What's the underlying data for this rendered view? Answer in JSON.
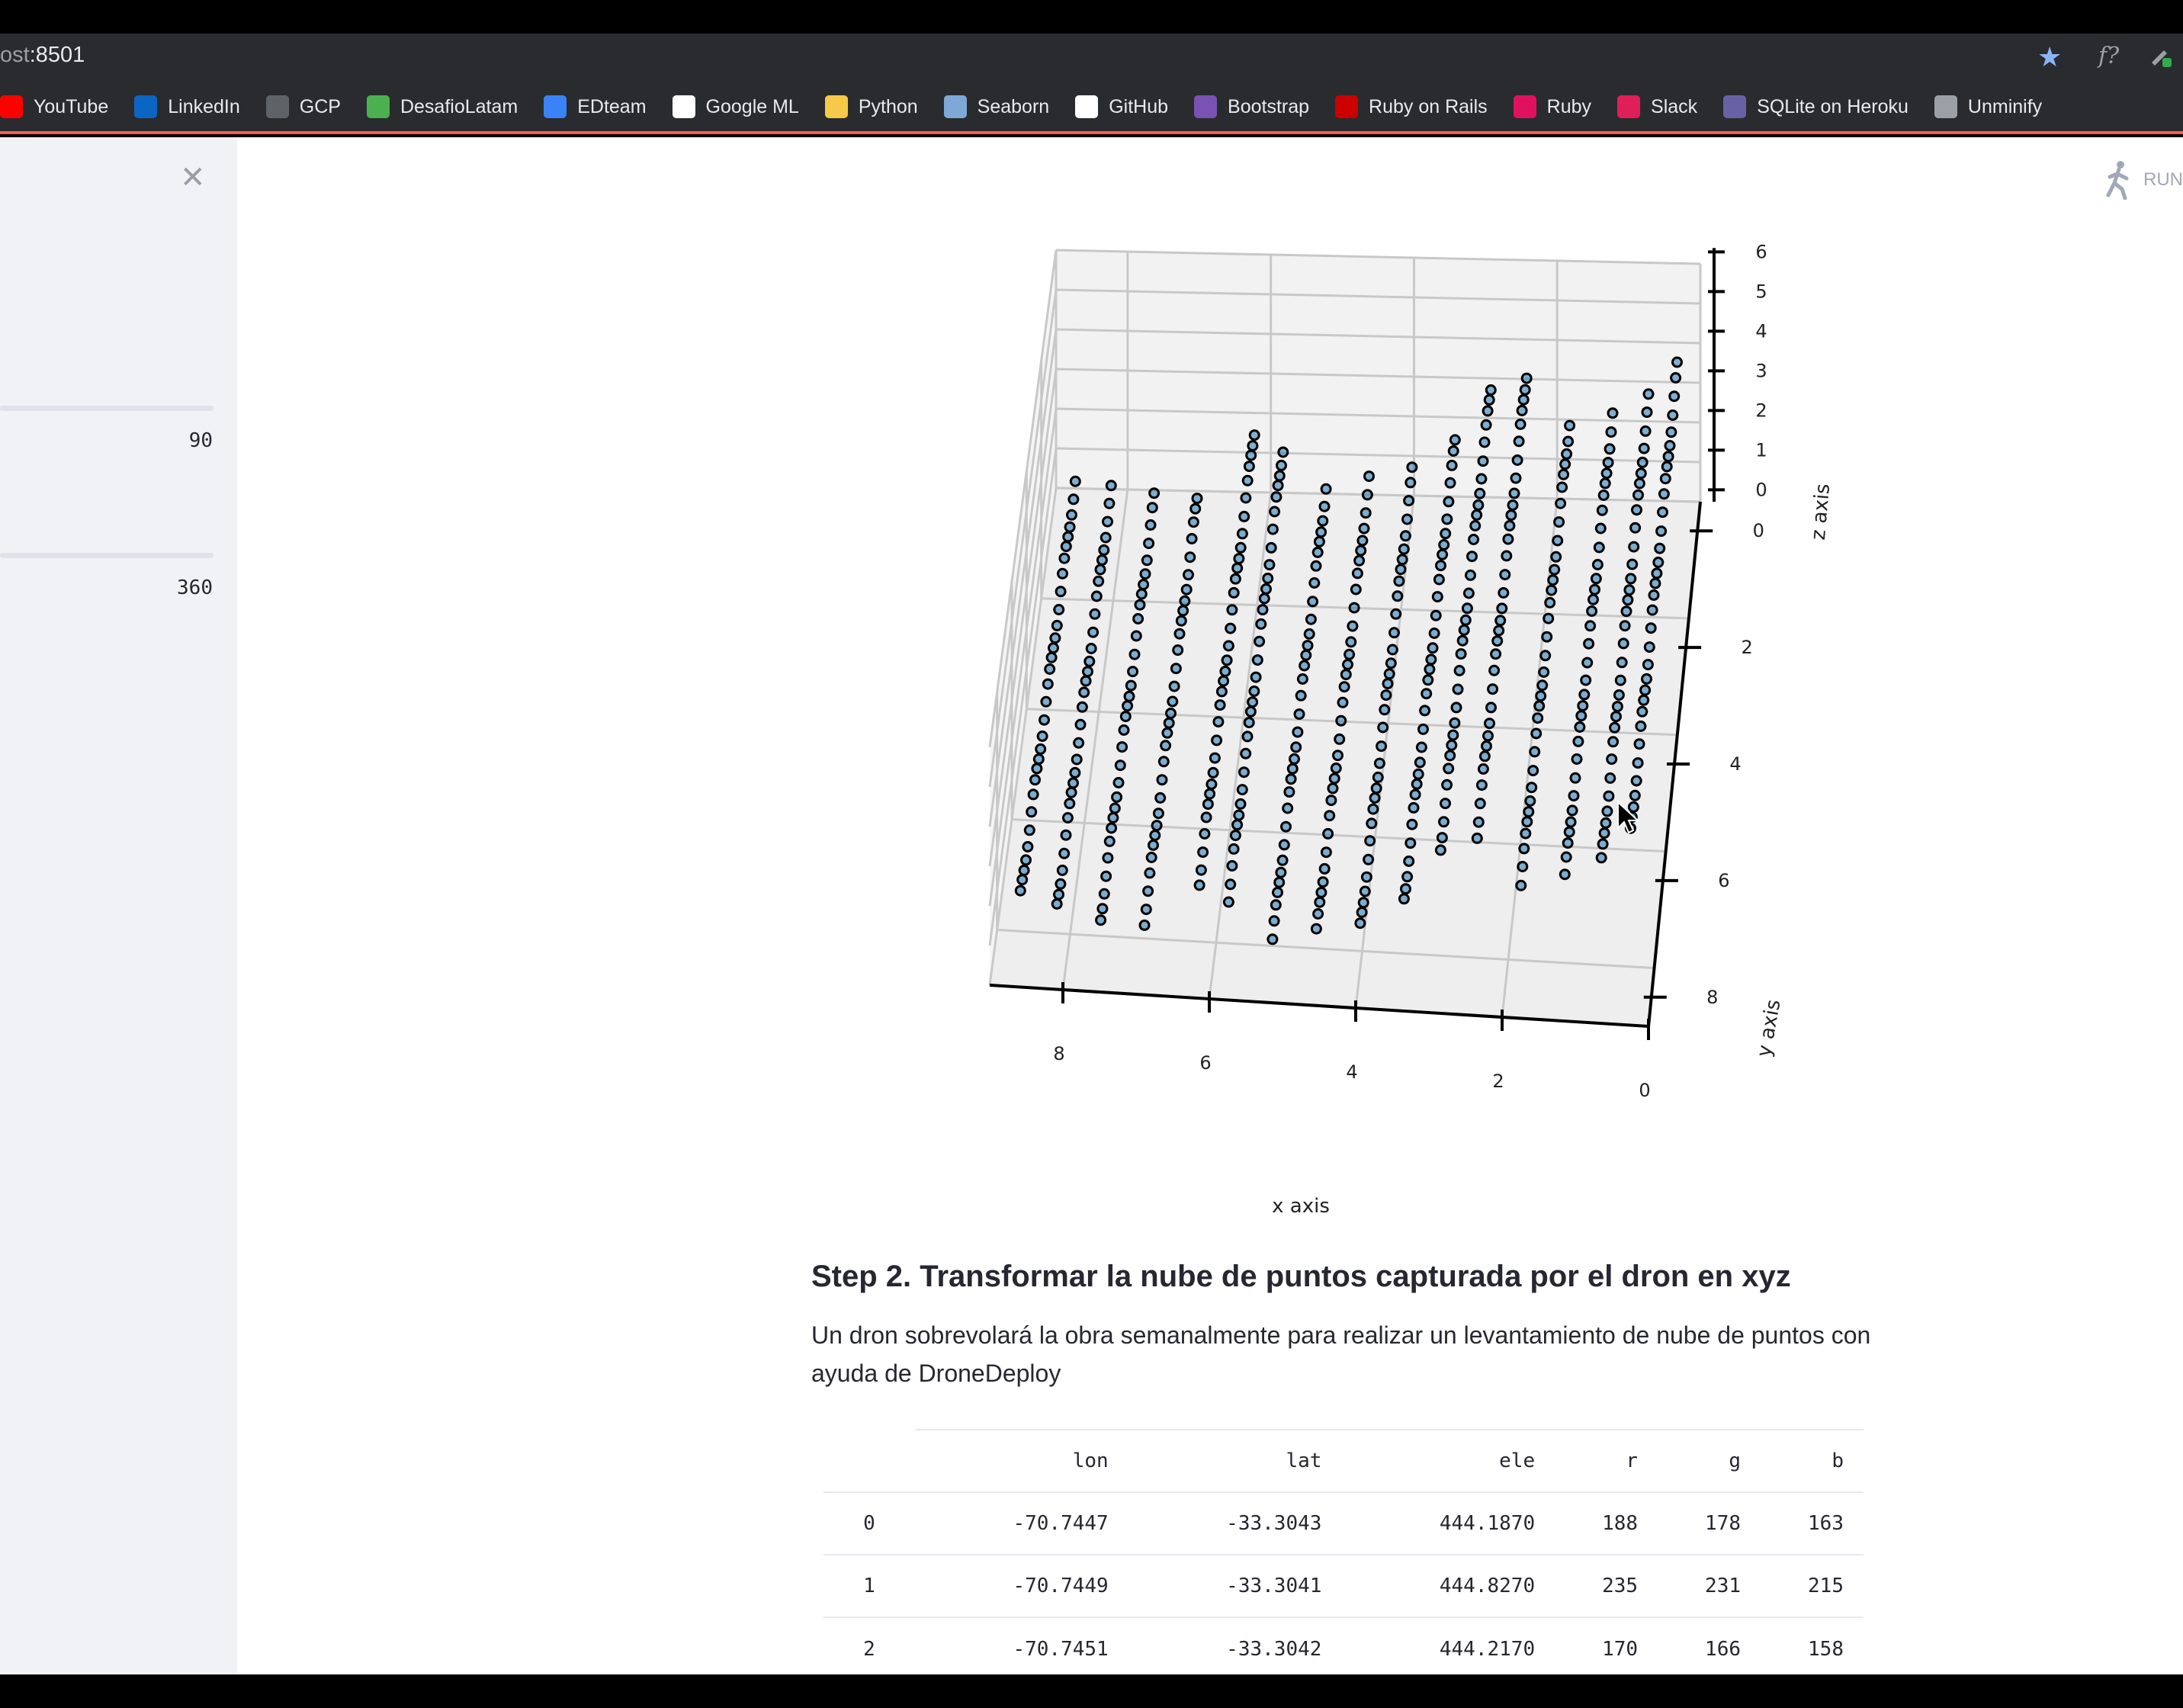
{
  "browser": {
    "url_prefix": "ost",
    "url_port": ":8501",
    "bookmarks": [
      {
        "label": "YouTube",
        "icon": "youtube-icon",
        "color": "#ff0000"
      },
      {
        "label": "LinkedIn",
        "icon": "linkedin-icon",
        "color": "#0a66c2"
      },
      {
        "label": "GCP",
        "icon": "gcp-icon",
        "color": "#5f6368"
      },
      {
        "label": "DesafioLatam",
        "icon": "desafiolatam-icon",
        "color": "#4caf50"
      },
      {
        "label": "EDteam",
        "icon": "edteam-icon",
        "color": "#3b82f6"
      },
      {
        "label": "Google ML",
        "icon": "google-ml-icon",
        "color": "#ffffff"
      },
      {
        "label": "Python",
        "icon": "python-icon",
        "color": "#f7c948"
      },
      {
        "label": "Seaborn",
        "icon": "seaborn-icon",
        "color": "#7fa8d6"
      },
      {
        "label": "GitHub",
        "icon": "github-icon",
        "color": "#ffffff"
      },
      {
        "label": "Bootstrap",
        "icon": "bootstrap-icon",
        "color": "#7952b3"
      },
      {
        "label": "Ruby on Rails",
        "icon": "rails-icon",
        "color": "#cc0000"
      },
      {
        "label": "Ruby",
        "icon": "ruby-icon",
        "color": "#e0115f"
      },
      {
        "label": "Slack",
        "icon": "slack-icon",
        "color": "#e01e5a"
      },
      {
        "label": "SQLite on Heroku",
        "icon": "heroku-icon",
        "color": "#6762a6"
      },
      {
        "label": "Unminify",
        "icon": "unminify-icon",
        "color": "#9aa0a6"
      }
    ]
  },
  "sidebar": {
    "slider1_value": "90",
    "slider2_value": "360"
  },
  "header": {
    "run_label": "RUN"
  },
  "chart_data": {
    "type": "scatter",
    "title": "",
    "xlabel": "x axis",
    "ylabel": "y axis",
    "zlabel": "z axis",
    "x_ticks": [
      "8",
      "6",
      "4",
      "2",
      "0"
    ],
    "y_ticks": [
      "0",
      "2",
      "4",
      "6",
      "8"
    ],
    "z_ticks": [
      "6",
      "5",
      "4",
      "3",
      "2",
      "1",
      "0"
    ],
    "xlim": [
      0,
      9
    ],
    "ylim": [
      0,
      9
    ],
    "zlim": [
      0,
      6
    ],
    "marker_color": "#1f77b4",
    "marker_edge": "#000000",
    "columns": [
      {
        "x": 8.7,
        "ymin": 0.3,
        "ymax": 8.0,
        "z": 0.6
      },
      {
        "x": 8.2,
        "ymin": 0.3,
        "ymax": 8.0,
        "z": 0.4
      },
      {
        "x": 7.6,
        "ymin": 0.3,
        "ymax": 8.0,
        "z": 0.2
      },
      {
        "x": 7.0,
        "ymin": 0.3,
        "ymax": 8.0,
        "z": 0.2
      },
      {
        "x": 6.2,
        "ymin": 0.3,
        "ymax": 8.3,
        "z": 2.0
      },
      {
        "x": 5.8,
        "ymin": 0.3,
        "ymax": 8.3,
        "z": 1.6
      },
      {
        "x": 5.2,
        "ymin": 0.3,
        "ymax": 8.3,
        "z": 0.6
      },
      {
        "x": 4.6,
        "ymin": 0.3,
        "ymax": 8.3,
        "z": 0.8
      },
      {
        "x": 4.0,
        "ymin": 0.3,
        "ymax": 8.3,
        "z": 1.0
      },
      {
        "x": 3.4,
        "ymin": 0.3,
        "ymax": 8.3,
        "z": 1.8
      },
      {
        "x": 2.9,
        "ymin": 0.3,
        "ymax": 8.3,
        "z": 3.2
      },
      {
        "x": 2.4,
        "ymin": 0.3,
        "ymax": 8.3,
        "z": 3.6
      },
      {
        "x": 1.8,
        "ymin": 0.3,
        "ymax": 8.3,
        "z": 2.4
      },
      {
        "x": 1.2,
        "ymin": 0.3,
        "ymax": 8.3,
        "z": 2.6
      },
      {
        "x": 0.7,
        "ymin": 0.3,
        "ymax": 8.3,
        "z": 3.0
      },
      {
        "x": 0.3,
        "ymin": 0.3,
        "ymax": 8.3,
        "z": 3.8
      }
    ]
  },
  "main": {
    "heading": "Step 2. Transformar la nube de puntos capturada por el dron en xyz",
    "paragraph": "Un dron sobrevolará la obra semanalmente para realizar un levantamiento de nube de puntos con ayuda de DroneDeploy",
    "table": {
      "columns": [
        "",
        "lon",
        "lat",
        "ele",
        "r",
        "g",
        "b"
      ],
      "rows": [
        [
          "0",
          "-70.7447",
          "-33.3043",
          "444.1870",
          "188",
          "178",
          "163"
        ],
        [
          "1",
          "-70.7449",
          "-33.3041",
          "444.8270",
          "235",
          "231",
          "215"
        ],
        [
          "2",
          "-70.7451",
          "-33.3042",
          "444.2170",
          "170",
          "166",
          "158"
        ]
      ]
    }
  }
}
